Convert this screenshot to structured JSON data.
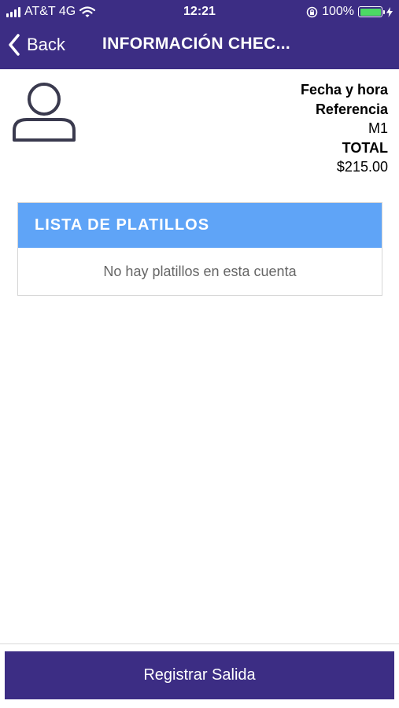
{
  "status_bar": {
    "carrier": "AT&T 4G",
    "time": "12:21",
    "battery": "100%",
    "battery_level": 1.0
  },
  "nav": {
    "back_label": "Back",
    "title": "INFORMACIÓN CHEC..."
  },
  "info": {
    "date_label": "Fecha y hora",
    "reference_label": "Referencia",
    "reference_value": "M1",
    "total_label": "TOTAL",
    "total_value": "$215.00"
  },
  "dishes": {
    "header": "LISTA DE PLATILLOS",
    "empty_message": "No hay platillos en esta cuenta"
  },
  "footer": {
    "checkout_label": "Registrar Salida"
  },
  "colors": {
    "primary": "#3c2d84",
    "panel_header": "#5fa4f7",
    "battery": "#4cd964"
  },
  "icons": {
    "back": "chevron-left-icon",
    "avatar": "person-icon",
    "wifi": "wifi-icon",
    "lock": "orientation-lock-icon",
    "charging": "lightning-icon"
  }
}
